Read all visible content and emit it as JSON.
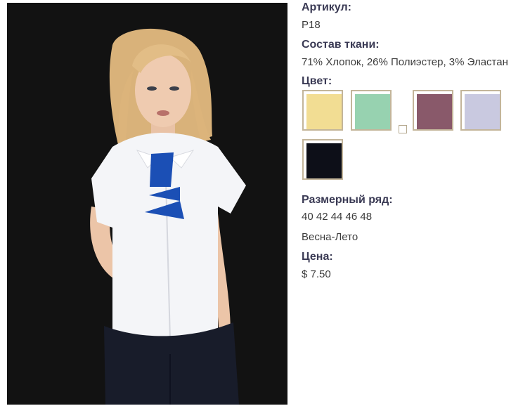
{
  "article": {
    "label": "Артикул:",
    "value": "P18"
  },
  "fabric": {
    "label": "Состав ткани:",
    "value": "71% Хлопок, 26% Полиэстер, 3% Эластан"
  },
  "color": {
    "label": "Цвет:",
    "swatches": [
      {
        "name": "yellow",
        "hex": "#f2dd93"
      },
      {
        "name": "green",
        "hex": "#97d2b0"
      },
      {
        "name": "plum",
        "hex": "#89596a"
      },
      {
        "name": "lavender",
        "hex": "#c9c9e0"
      },
      {
        "name": "black",
        "hex": "#0d0f18"
      }
    ]
  },
  "sizes": {
    "label": "Размерный ряд:",
    "value": "40 42 44 46 48"
  },
  "season": {
    "value": "Весна-Лето"
  },
  "price": {
    "label": "Цена:",
    "value": "$ 7.50"
  },
  "colors": {
    "label_text": "#3a3a54",
    "value_text": "#3c3c3c",
    "swatch_border": "#c3b59a",
    "photo_background": "#121212",
    "tie_accent": "#1b4fb5"
  }
}
